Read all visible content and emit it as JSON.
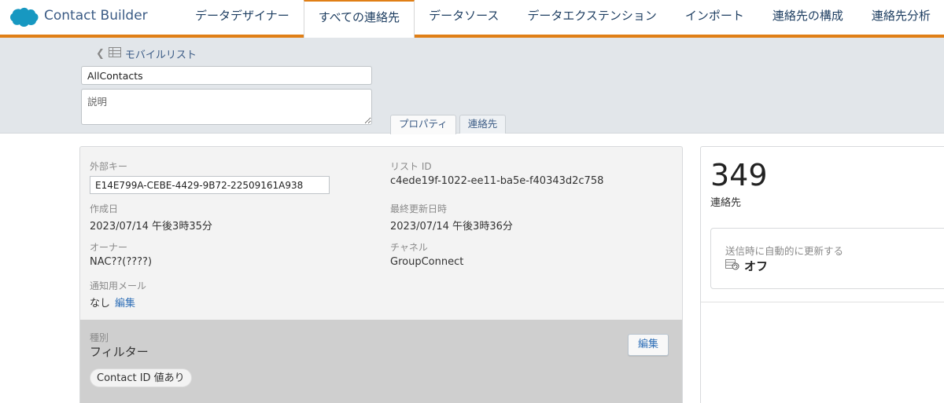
{
  "app": {
    "title": "Contact Builder"
  },
  "nav": {
    "tabs": [
      {
        "label": "データデザイナー"
      },
      {
        "label": "すべての連絡先"
      },
      {
        "label": "データソース"
      },
      {
        "label": "データエクステンション"
      },
      {
        "label": "インポート"
      },
      {
        "label": "連絡先の構成"
      },
      {
        "label": "連絡先分析"
      }
    ],
    "active_tab": "すべての連絡先"
  },
  "header": {
    "breadcrumb": "モバイルリスト",
    "name_value": "AllContacts",
    "description_placeholder": "説明",
    "subtabs": [
      {
        "label": "プロパティ"
      },
      {
        "label": "連絡先"
      }
    ]
  },
  "properties": {
    "external_key": {
      "label": "外部キー",
      "value": "E14E799A-CEBE-4429-9B72-22509161A938"
    },
    "list_id": {
      "label": "リスト ID",
      "value": "c4ede19f-1022-ee11-ba5e-f40343d2c758"
    },
    "created": {
      "label": "作成日",
      "value": "2023/07/14 午後3時35分"
    },
    "modified": {
      "label": "最終更新日時",
      "value": "2023/07/14 午後3時36分"
    },
    "owner": {
      "label": "オーナー",
      "value": "NAC??(????)"
    },
    "channel": {
      "label": "チャネル",
      "value": "GroupConnect"
    },
    "notify_email": {
      "label": "通知用メール",
      "value": "なし",
      "edit_link": "編集"
    }
  },
  "kind": {
    "label": "種別",
    "value": "フィルター",
    "edit_button": "編集",
    "filter_pill": "Contact ID  値あり"
  },
  "summary": {
    "count": "349",
    "count_label": "連絡先",
    "auto_update_label": "送信時に自動的に更新する",
    "auto_update_value": "オフ"
  },
  "colors": {
    "accent": "#e07f16",
    "link": "#2f6fb7",
    "brand": "#1798c1"
  },
  "icons": [
    "salesforce-logo",
    "chevron-left-icon",
    "list-icon",
    "refresh-table-icon"
  ]
}
